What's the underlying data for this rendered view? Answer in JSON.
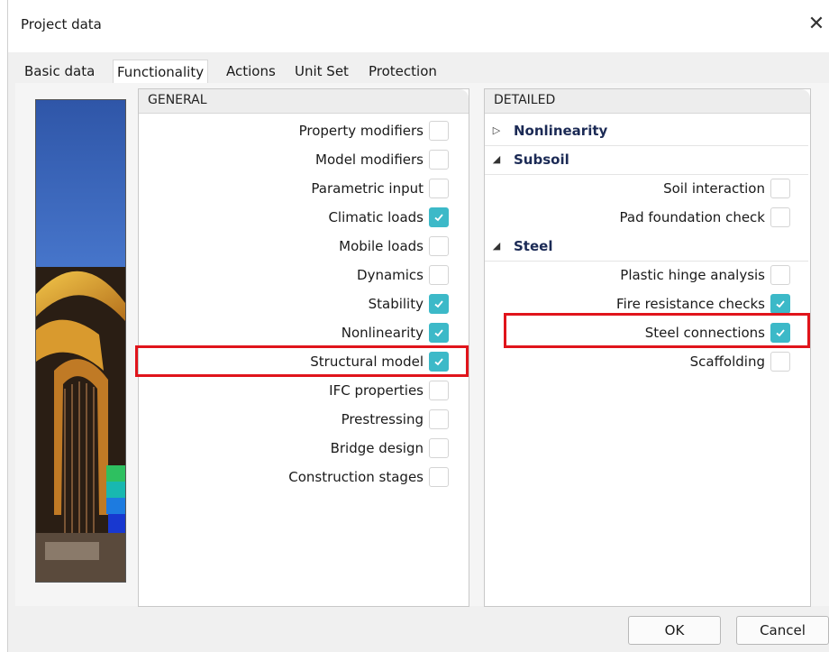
{
  "window": {
    "title": "Project data",
    "close_glyph": "✕"
  },
  "tabs": [
    {
      "label": "Basic data",
      "active": false
    },
    {
      "label": "Functionality",
      "active": true
    },
    {
      "label": "Actions",
      "active": false
    },
    {
      "label": "Unit Set",
      "active": false
    },
    {
      "label": "Protection",
      "active": false
    }
  ],
  "general": {
    "header": "GENERAL",
    "items": [
      {
        "label": "Property modifiers",
        "checked": false
      },
      {
        "label": "Model modifiers",
        "checked": false
      },
      {
        "label": "Parametric input",
        "checked": false
      },
      {
        "label": "Climatic loads",
        "checked": true
      },
      {
        "label": "Mobile loads",
        "checked": false
      },
      {
        "label": "Dynamics",
        "checked": false
      },
      {
        "label": "Stability",
        "checked": true
      },
      {
        "label": "Nonlinearity",
        "checked": true
      },
      {
        "label": "Structural model",
        "checked": true,
        "highlighted": true
      },
      {
        "label": "IFC properties",
        "checked": false
      },
      {
        "label": "Prestressing",
        "checked": false
      },
      {
        "label": "Bridge design",
        "checked": false
      },
      {
        "label": "Construction stages",
        "checked": false
      }
    ]
  },
  "detailed": {
    "header": "DETAILED",
    "sections": [
      {
        "title": "Nonlinearity",
        "expanded": false,
        "arrow": "▷",
        "items": []
      },
      {
        "title": "Subsoil",
        "expanded": true,
        "arrow": "◢",
        "items": [
          {
            "label": "Soil interaction",
            "checked": false
          },
          {
            "label": "Pad foundation check",
            "checked": false
          }
        ]
      },
      {
        "title": "Steel",
        "expanded": true,
        "arrow": "◢",
        "items": [
          {
            "label": "Plastic hinge analysis",
            "checked": false
          },
          {
            "label": "Fire resistance checks",
            "checked": true
          },
          {
            "label": "Steel connections",
            "checked": true,
            "highlighted": true
          },
          {
            "label": "Scaffolding",
            "checked": false
          }
        ]
      }
    ]
  },
  "buttons": {
    "ok": "OK",
    "cancel": "Cancel"
  },
  "colors": {
    "checkbox_checked": "#3cb9c8",
    "highlight": "#e0141b",
    "section_title": "#1b2a55"
  }
}
